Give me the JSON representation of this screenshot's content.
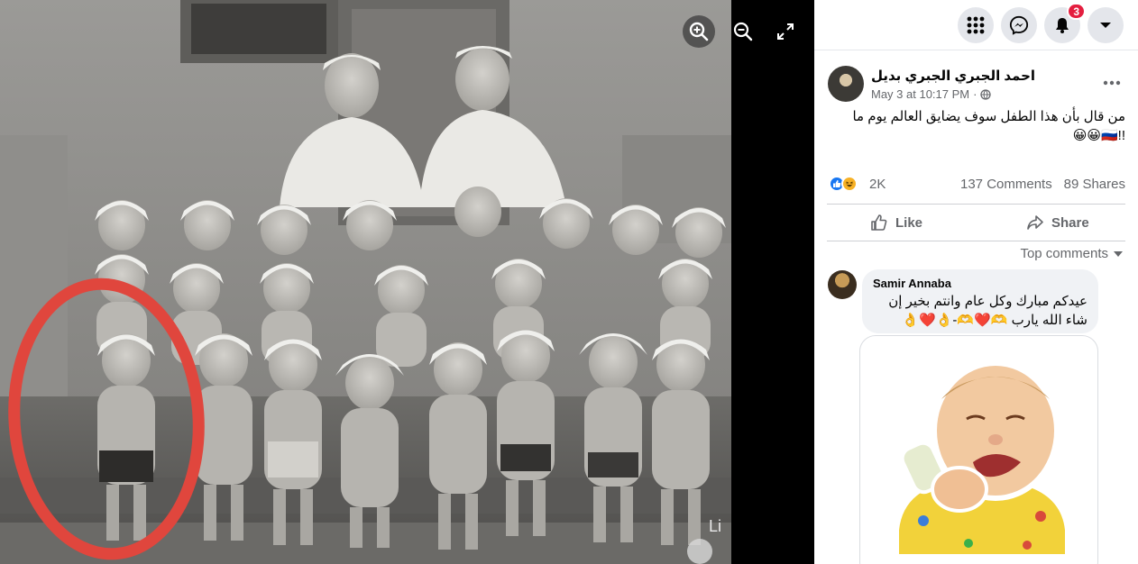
{
  "viewer": {
    "zoom_in_icon": "zoom-in-icon",
    "zoom_out_icon": "zoom-out-icon",
    "fullscreen_icon": "fullscreen-icon",
    "watermark": "Li"
  },
  "topbar": {
    "menu_icon": "grid-menu-icon",
    "messenger_icon": "messenger-icon",
    "notifications_icon": "bell-icon",
    "notifications_badge": "3",
    "account_icon": "caret-down-icon"
  },
  "post": {
    "author": "احمد الجبري الجبري بديل",
    "timestamp": "May 3 at 10:17 PM",
    "separator": "·",
    "privacy_icon": "globe-icon",
    "text_line1": "من قال بأن هذا الطفل سوف يضايق العالم يوم ما",
    "text_line2": "!!🇷🇺😀😀",
    "reactions_count": "2K",
    "comments_count": "137 Comments",
    "shares_count": "89 Shares",
    "like_label": "Like",
    "share_label": "Share",
    "top_comments_label": "Top comments"
  },
  "comment": {
    "author": "Samir Annaba",
    "text": "عيدكم مبارك وكل عام وانتم بخير إن شاء الله يارب 🫶❤️🫶-👌❤️👌"
  },
  "colors": {
    "accent": "#1877f2",
    "badge": "#e41e3f",
    "circle_annotation": "#e0463d"
  }
}
